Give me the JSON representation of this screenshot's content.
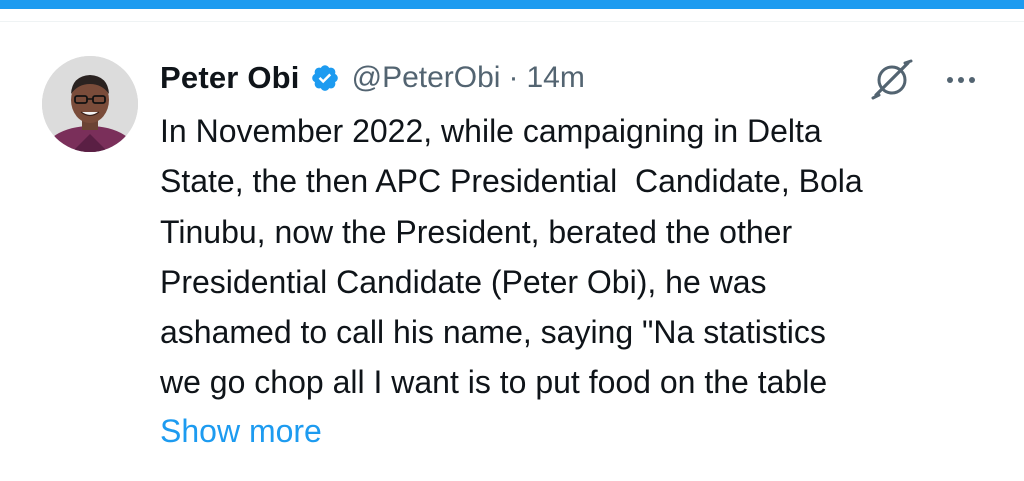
{
  "tweet": {
    "author": {
      "name": "Peter Obi",
      "handle": "@PeterObi",
      "verified": true,
      "avatar_icon": "profile-photo-avatar"
    },
    "separator": "·",
    "time": "14m",
    "text_lines": [
      "In November 2022, while campaigning in Delta",
      "State, the then APC Presidential  Candidate, Bola",
      "Tinubu, now the President, berated the other",
      "Presidential Candidate (Peter Obi), he was",
      "ashamed to call his name, saying \"Na statistics",
      "we go chop all I want is to put food on the table"
    ],
    "show_more_label": "Show more",
    "icons": {
      "grok": "grok-icon",
      "more": "more-options-icon",
      "verified": "verified-badge-icon"
    }
  },
  "colors": {
    "accent": "#1d9bf0",
    "text": "#0f1419",
    "muted": "#536471",
    "background": "#ffffff"
  }
}
